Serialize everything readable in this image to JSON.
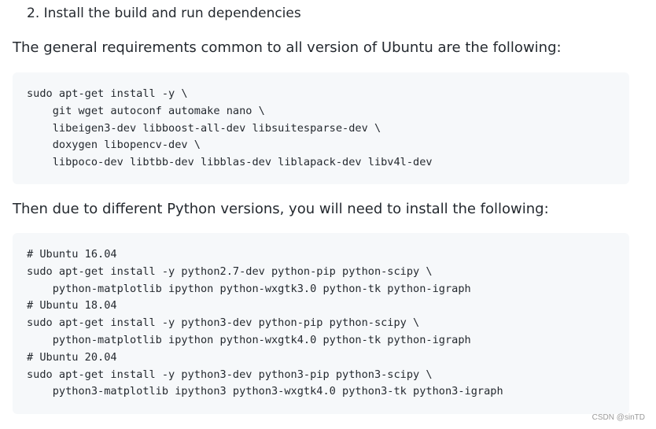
{
  "heading": "2. Install the build and run dependencies",
  "paragraph_1": "The general requirements common to all version of Ubuntu are the following:",
  "code_block_1": [
    "sudo apt-get install -y \\",
    "    git wget autoconf automake nano \\",
    "    libeigen3-dev libboost-all-dev libsuitesparse-dev \\",
    "    doxygen libopencv-dev \\",
    "    libpoco-dev libtbb-dev libblas-dev liblapack-dev libv4l-dev"
  ],
  "paragraph_2": "Then due to different Python versions, you will need to install the following:",
  "code_block_2": [
    "# Ubuntu 16.04",
    "sudo apt-get install -y python2.7-dev python-pip python-scipy \\",
    "    python-matplotlib ipython python-wxgtk3.0 python-tk python-igraph",
    "# Ubuntu 18.04",
    "sudo apt-get install -y python3-dev python-pip python-scipy \\",
    "    python-matplotlib ipython python-wxgtk4.0 python-tk python-igraph",
    "# Ubuntu 20.04",
    "sudo apt-get install -y python3-dev python3-pip python3-scipy \\",
    "    python3-matplotlib ipython3 python3-wxgtk4.0 python3-tk python3-igraph"
  ],
  "watermark": "CSDN @sinTD"
}
